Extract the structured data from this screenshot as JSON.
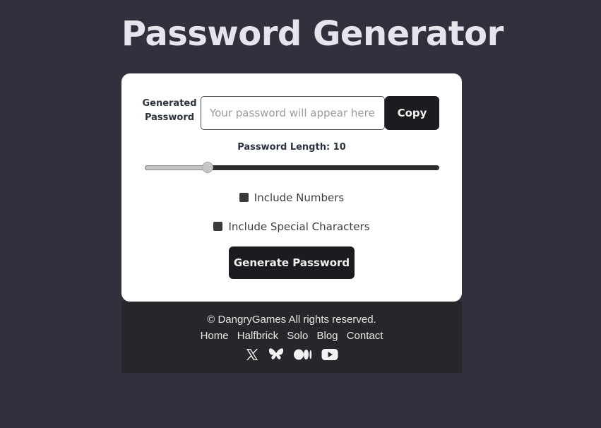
{
  "title": "Password Generator",
  "generator": {
    "password_label": "Generated Password",
    "password_value": "",
    "password_placeholder": "Your password will appear here",
    "copy_label": "Copy",
    "length_label": "Password Length: 10",
    "length": {
      "value": 10,
      "min": 4,
      "max": 32
    },
    "numbers_label": "Include Numbers",
    "numbers_checked": false,
    "special_label": "Include Special Characters",
    "special_checked": false,
    "generate_label": "Generate Password"
  },
  "footer": {
    "copyright": "© DangryGames All rights reserved.",
    "links": [
      "Home",
      "Halfbrick",
      "Solo",
      "Blog",
      "Contact"
    ],
    "socials": [
      "x-icon",
      "bluesky-icon",
      "medium-icon",
      "youtube-icon"
    ]
  },
  "colors": {
    "background": "#31303c",
    "card": "#ffffff",
    "button": "#1c1b1f",
    "footer": "#26262b"
  }
}
